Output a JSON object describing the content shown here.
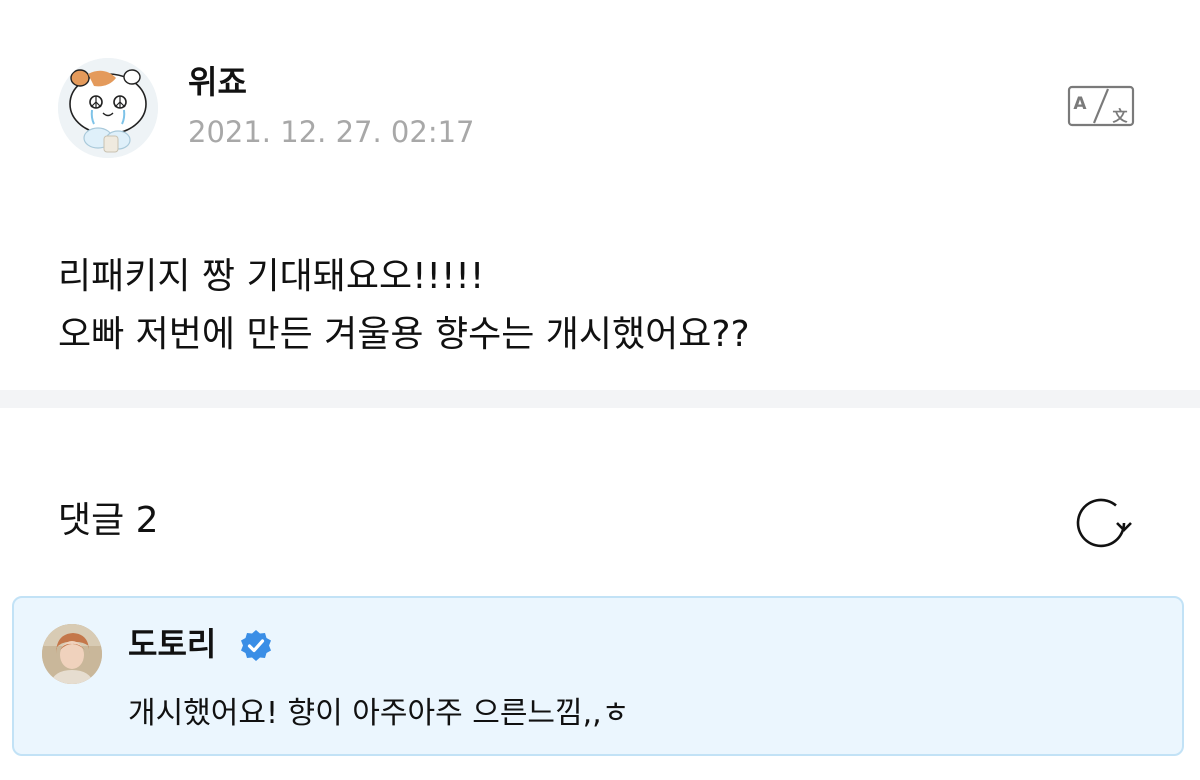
{
  "post": {
    "author_name": "위죠",
    "date": "2021. 12. 27. 02:17",
    "body_lines": [
      "리패키지 짱 기대돼요오!!!!!",
      "오빠 저번에 만든 겨울용 향수는 개시했어요??"
    ],
    "translate_icon": "translate-icon"
  },
  "comments_section": {
    "header_label": "댓글 2",
    "refresh_icon": "refresh-icon",
    "comments": [
      {
        "author_name": "도토리",
        "verified": true,
        "text": "개시했어요! 향이 아주아주 으른느낌,,ㅎ"
      }
    ]
  },
  "colors": {
    "date_gray": "#a8a8a8",
    "divider": "#f3f4f6",
    "comment_bg": "#ebf6fe",
    "comment_border": "#c2e2f6",
    "verified_blue": "#3a8ee6"
  }
}
